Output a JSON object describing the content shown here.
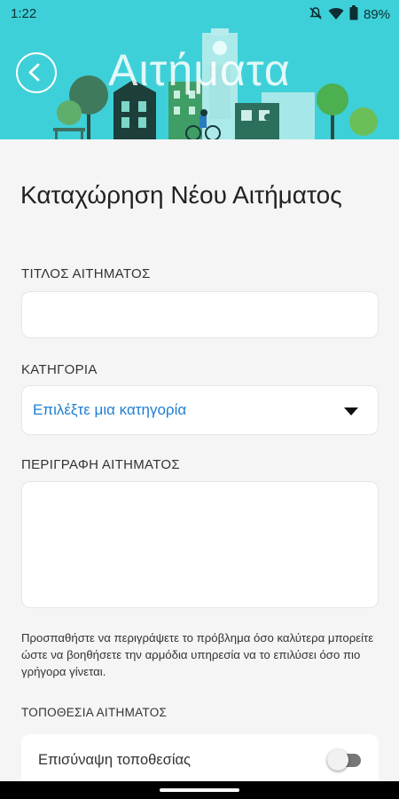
{
  "status_bar": {
    "time": "1:22",
    "battery": "89%",
    "icons": [
      "mute-bell-icon",
      "wifi-icon",
      "battery-icon"
    ]
  },
  "header": {
    "title": "Αιτήματα",
    "background_color": "#3ed0d8",
    "back_icon": "chevron-left-icon"
  },
  "form": {
    "page_title": "Καταχώρηση Νέου Αιτήματος",
    "title_label": "ΤΙΤΛΟΣ ΑΙΤΗΜΑΤΟΣ",
    "title_value": "",
    "category_label": "ΚΑΤΗΓΟΡΙΑ",
    "category_value": "Επιλέξτε μια κατηγορία",
    "description_label": "ΠΕΡΙΓΡΑΦΗ ΑΙΤΗΜΑΤΟΣ",
    "description_value": "",
    "hint": "Προσπαθήστε να περιγράψετε το πρόβλημα όσο καλύτερα μπορείτε ώστε να βοηθήσετε την αρμόδια υπηρεσία να το επιλύσει όσο πιο γρήγορα γίνεται.",
    "location_label": "ΤΟΠΟΘΕΣΙΑ ΑΙΤΗΜΑΤΟΣ",
    "attach_location_label": "Επισύναψη τοποθεσίας",
    "attach_location_on": false
  },
  "colors": {
    "accent": "#1e7ed2",
    "header": "#3ed0d8"
  }
}
